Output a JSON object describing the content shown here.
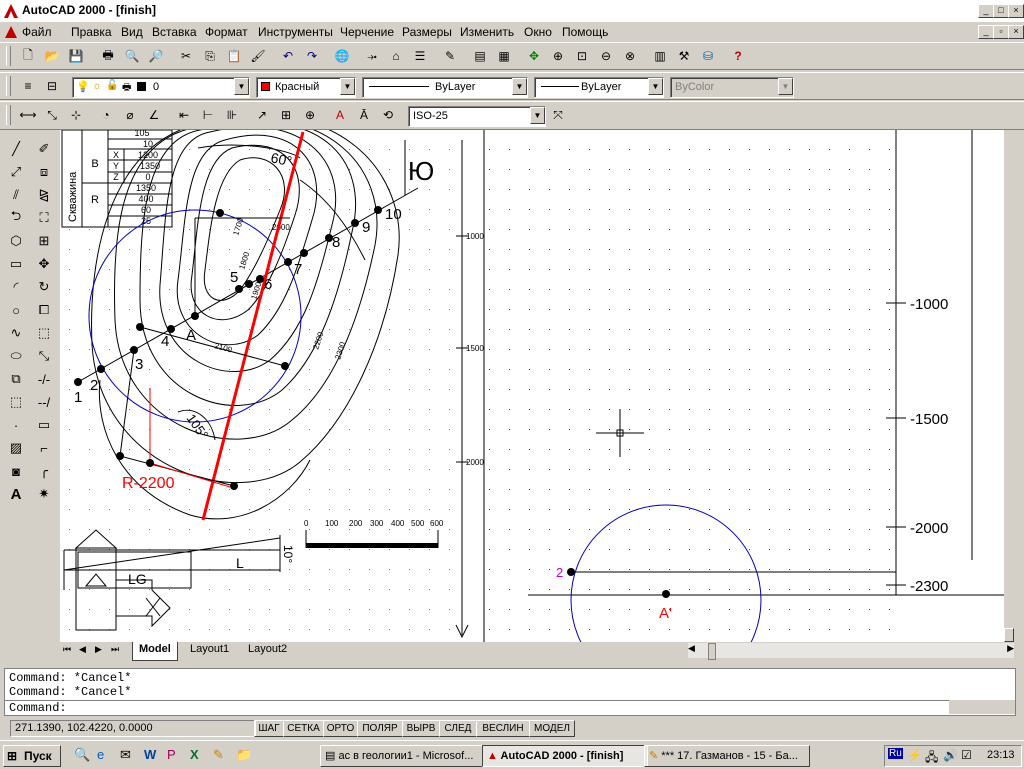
{
  "window": {
    "title": "AutoCAD 2000 - [finish]"
  },
  "menu": [
    "Файл",
    "Правка",
    "Вид",
    "Вставка",
    "Формат",
    "Инструменты",
    "Черчение",
    "Размеры",
    "Изменить",
    "Окно",
    "Помощь"
  ],
  "properties": {
    "layer": "0",
    "color": "Красный",
    "linetype": "ByLayer",
    "lineweight": "ByLayer",
    "plotstyle": "ByColor"
  },
  "dimstyle": "ISO-25",
  "table": {
    "vertical_label": "Скважина",
    "top_value": "105",
    "rows": [
      {
        "group": "",
        "axis": "",
        "value": "10"
      },
      {
        "group": "B",
        "axis": "X",
        "value": "1200"
      },
      {
        "group": "",
        "axis": "Y",
        "value": "1350"
      },
      {
        "group": "",
        "axis": "Z",
        "value": "0"
      },
      {
        "group": "",
        "axis": "",
        "value": "1350"
      },
      {
        "group": "R",
        "axis": "",
        "value": "400"
      },
      {
        "group": "",
        "axis": "",
        "value": "60"
      },
      {
        "group": "",
        "axis": "",
        "value": "25"
      }
    ]
  },
  "drawing": {
    "north_label": "Ю",
    "angle_label": "60°",
    "angle2_label": "105°",
    "point_labels": [
      "1",
      "2",
      "3",
      "4",
      "5",
      "6",
      "7",
      "8",
      "9",
      "10"
    ],
    "label_A": "A",
    "label_R": "R-2200",
    "label_L": "L",
    "label_LG": "LG",
    "slope_label": "10°",
    "contours": [
      "1700",
      "1800",
      "1900",
      "2000",
      "2100",
      "2200",
      "2300"
    ],
    "scale_ticks": [
      "0",
      "100",
      "200",
      "300",
      "400",
      "500",
      "600"
    ],
    "axis_mid": [
      "1000",
      "1500",
      "2000"
    ],
    "axis_right": [
      "-1000",
      "-1500",
      "-2000",
      "-2300"
    ],
    "label_A2": "A'",
    "label_2": "2"
  },
  "tabs": [
    "Model",
    "Layout1",
    "Layout2"
  ],
  "command": {
    "lines": [
      "Command: *Cancel*",
      "Command: *Cancel*"
    ],
    "prompt": "Command:"
  },
  "status": {
    "coords": "271.1390, 102.4220, 0.0000",
    "buttons": [
      "ШАГ",
      "СЕТКА",
      "ОРТО",
      "ПОЛЯР",
      "ВЫРВ",
      "СЛЕД",
      "ВЕСЛИН",
      "МОДЕЛ"
    ]
  },
  "taskbar": {
    "start": "Пуск",
    "items": [
      "ас в геологии1 - Microsof...",
      "AutoCAD 2000 - [finish]",
      "*** 17. Газманов - 15 - Ба..."
    ],
    "lang": "Ru",
    "clock": "23:13"
  },
  "colors": {
    "red": "#ff0000",
    "blue": "#0000c0",
    "magenta": "#c000c0"
  }
}
